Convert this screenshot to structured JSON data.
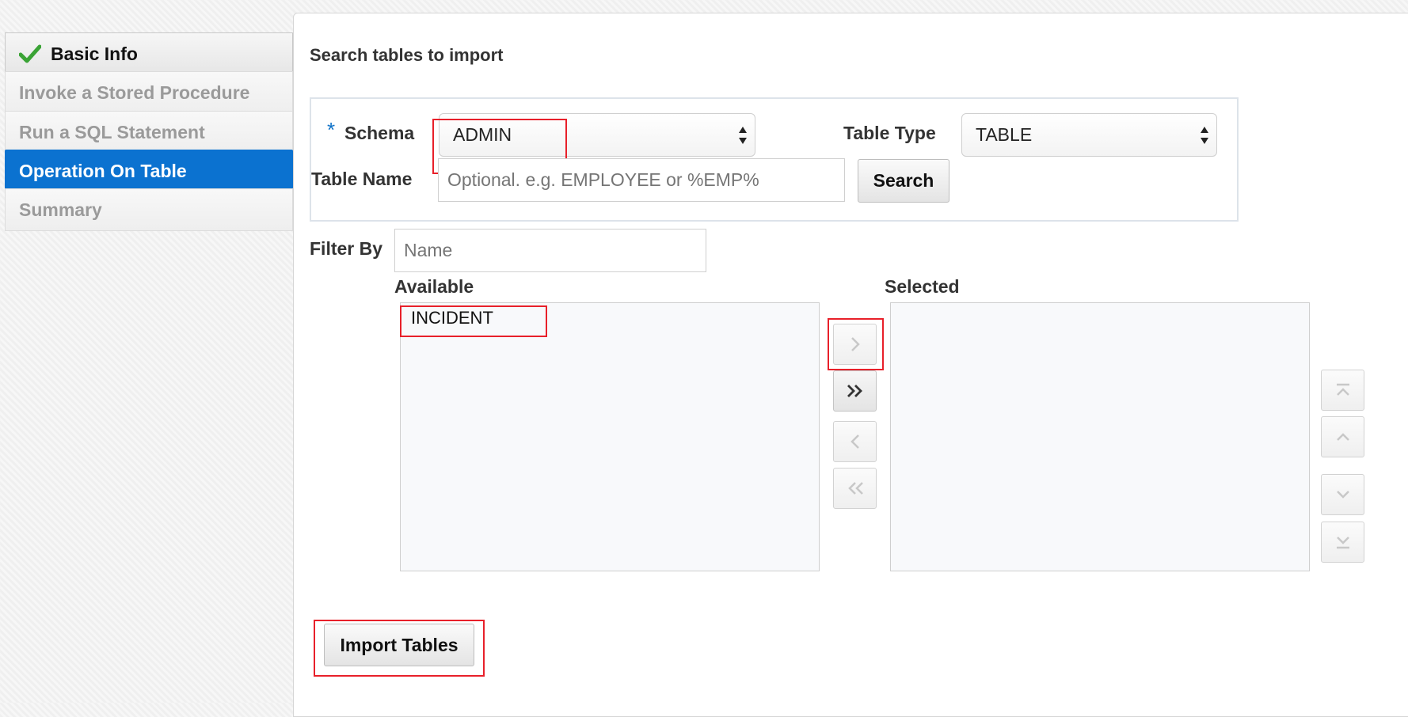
{
  "train": {
    "steps": [
      {
        "label": "Basic Info",
        "state": "done"
      },
      {
        "label": "Invoke a Stored Procedure",
        "state": "disabled"
      },
      {
        "label": "Run a SQL Statement",
        "state": "disabled"
      },
      {
        "label": "Operation On Table",
        "state": "current"
      },
      {
        "label": "Summary",
        "state": "disabled"
      }
    ]
  },
  "main": {
    "heading": "Search tables to import",
    "schema_label": "Schema",
    "required_marker": "*",
    "schema_value": "ADMIN",
    "table_type_label": "Table Type",
    "table_type_value": "TABLE",
    "table_name_label": "Table Name",
    "table_name_placeholder": "Optional. e.g. EMPLOYEE or %EMP%",
    "search_button": "Search",
    "filter_label": "Filter By",
    "filter_placeholder": "Name",
    "available_label": "Available",
    "available_items": [
      "INCIDENT"
    ],
    "selected_label": "Selected",
    "selected_items": [],
    "import_button": "Import Tables"
  },
  "colors": {
    "accent": "#0b72d0",
    "highlight": "#e8202a",
    "check": "#3aa335"
  }
}
